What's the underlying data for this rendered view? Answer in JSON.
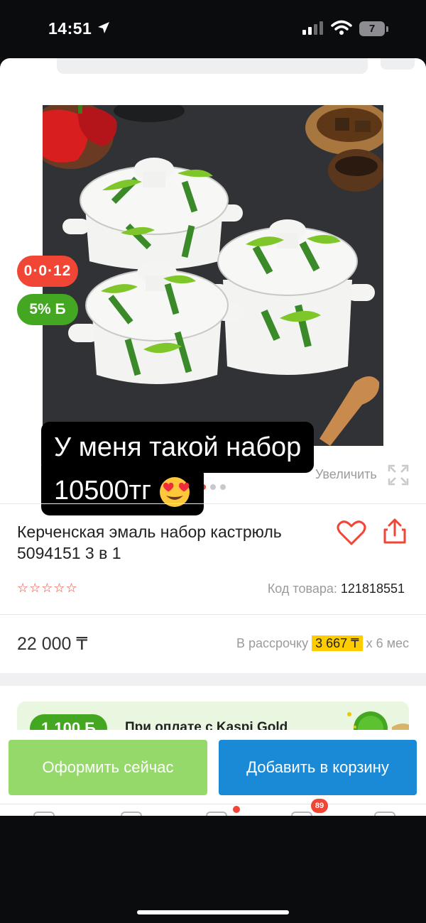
{
  "status_bar": {
    "time": "14:51",
    "battery": "7",
    "icons": [
      "location-arrow-icon",
      "cellular-signal-icon",
      "wifi-icon",
      "battery-icon"
    ]
  },
  "product": {
    "badges": {
      "installment": "0·0·12",
      "bonus": "5% Б"
    },
    "title": "Керченская эмаль набор кастрюль 5094151 3 в 1",
    "zoom_label": "Увеличить",
    "rating_stars": "☆☆☆☆☆",
    "sku_label": "Код товара:",
    "sku_value": "121818551",
    "price": "22 000 ₸",
    "installment_label": "В рассрочку",
    "installment_amount": "3 667 ₸",
    "installment_term": "х 6 мес",
    "carousel_dots": 3,
    "active_dot": 1
  },
  "overlay": {
    "line1": "У меня такой набор",
    "line2": "10500тг"
  },
  "promo": {
    "pill": "1 100 Б",
    "text": "При оплате с Kaspi Gold"
  },
  "actions": {
    "buy_now": "Оформить сейчас",
    "add_to_cart": "Добавить в корзину"
  },
  "tabbar": {
    "badge_count": "89"
  },
  "colors": {
    "accent_red": "#f14635",
    "bonus_green": "#44a721",
    "buy_now_green": "#96d96b",
    "cart_blue": "#1a8ad7",
    "installment_yellow": "#ffcc00"
  }
}
